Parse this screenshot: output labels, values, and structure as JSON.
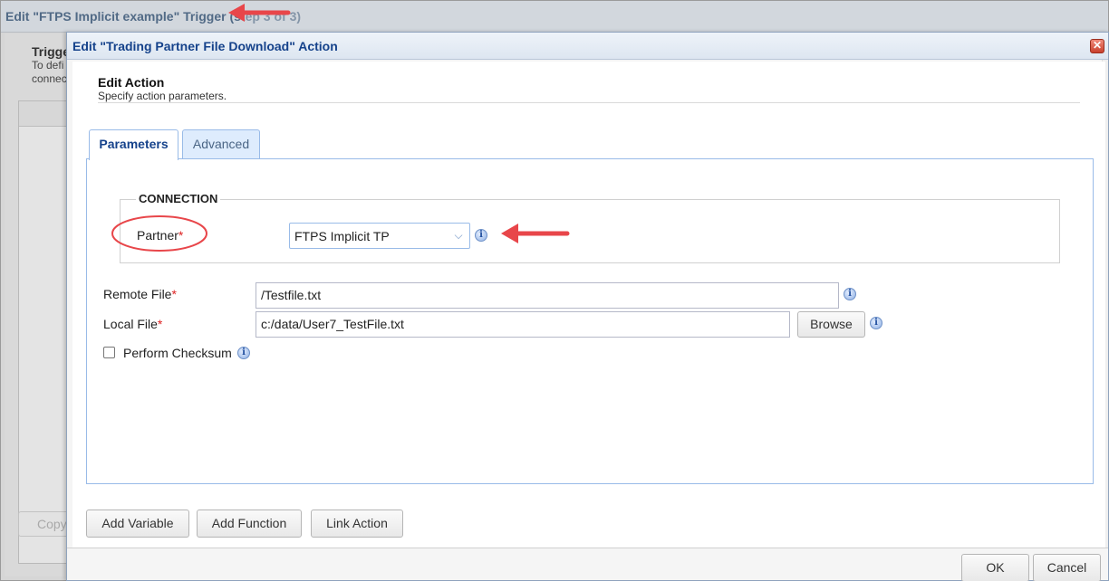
{
  "background_dialog": {
    "title": "Edit \"FTPS Implicit example\" Trigger (st",
    "title_hidden": "ep 3 of 3)",
    "heading": "Trigger",
    "desc_line1": "To defi",
    "desc_line2": "connec",
    "copy_button": "Copy"
  },
  "dialog": {
    "title": "Edit \"Trading Partner File Download\" Action",
    "close_icon": "close-icon",
    "section_title": "Edit Action",
    "section_subtitle": "Specify action parameters.",
    "tabs": [
      {
        "label": "Parameters",
        "active": true
      },
      {
        "label": "Advanced",
        "active": false
      }
    ],
    "connection": {
      "legend": "CONNECTION",
      "partner_label": "Partner",
      "partner_value": "FTPS Implicit TP"
    },
    "remote_file": {
      "label": "Remote File",
      "value": "/Testfile.txt"
    },
    "local_file": {
      "label": "Local File",
      "value": "c:/data/User7_TestFile.txt",
      "browse_label": "Browse"
    },
    "checksum": {
      "label": "Perform Checksum",
      "checked": false
    },
    "required_marker": "*",
    "bottom_buttons": [
      "Add Variable",
      "Add Function",
      "Link Action"
    ],
    "ok_label": "OK",
    "cancel_label": "Cancel"
  },
  "colors": {
    "title_text": "#15428b",
    "tab_border": "#99bbe8",
    "annotation_red": "#e8464a",
    "required": "#dd2222"
  }
}
